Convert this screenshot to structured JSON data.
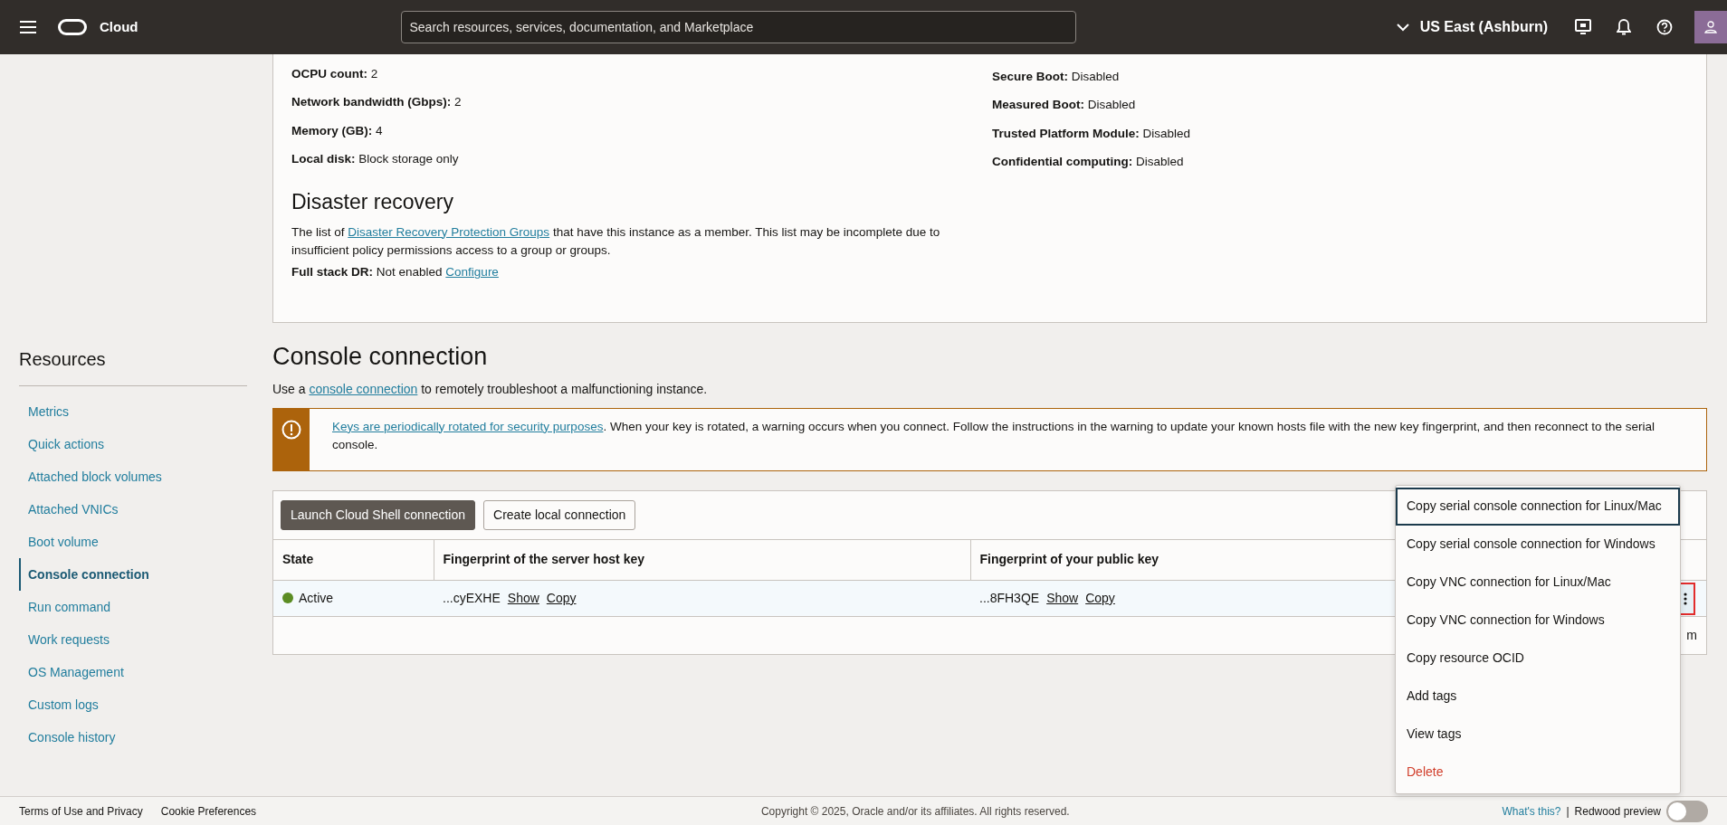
{
  "header": {
    "logo_text": "Cloud",
    "search": {
      "placeholder": "Search resources, services, documentation, and Marketplace"
    },
    "region": "US East (Ashburn)"
  },
  "details": {
    "left": [
      {
        "label": "OCPU count:",
        "value": "2"
      },
      {
        "label": "Network bandwidth (Gbps):",
        "value": "2"
      },
      {
        "label": "Memory (GB):",
        "value": "4"
      },
      {
        "label": "Local disk:",
        "value": "Block storage only"
      }
    ],
    "right": [
      {
        "label": "Secure Boot:",
        "value": "Disabled"
      },
      {
        "label": "Measured Boot:",
        "value": "Disabled"
      },
      {
        "label": "Trusted Platform Module:",
        "value": "Disabled"
      },
      {
        "label": "Confidential computing:",
        "value": "Disabled"
      }
    ],
    "disaster_recovery": {
      "title": "Disaster recovery",
      "text_before": "The list of ",
      "link": "Disaster Recovery Protection Groups",
      "text_after": " that have this instance as a member. This list may be incomplete due to insufficient policy permissions access to a group or groups.",
      "full_stack": {
        "label": "Full stack DR:",
        "value": "Not enabled",
        "link": "Configure"
      }
    }
  },
  "sidebar": {
    "title": "Resources",
    "items": [
      {
        "label": "Metrics",
        "selected": false
      },
      {
        "label": "Quick actions",
        "selected": false
      },
      {
        "label": "Attached block volumes",
        "selected": false
      },
      {
        "label": "Attached VNICs",
        "selected": false
      },
      {
        "label": "Boot volume",
        "selected": false
      },
      {
        "label": "Console connection",
        "selected": true
      },
      {
        "label": "Run command",
        "selected": false
      },
      {
        "label": "Work requests",
        "selected": false
      },
      {
        "label": "OS Management",
        "selected": false
      },
      {
        "label": "Custom logs",
        "selected": false
      },
      {
        "label": "Console history",
        "selected": false
      }
    ]
  },
  "console": {
    "title": "Console connection",
    "intro": {
      "before": "Use a ",
      "link": "console connection",
      "after": " to remotely troubleshoot a malfunctioning instance."
    },
    "alert": {
      "link": "Keys are periodically rotated for security purposes",
      "text": ". When your key is rotated, a warning occurs when you connect. Follow the instructions in the warning to update your known hosts file with the new key fingerprint, and then reconnect to the serial console."
    },
    "buttons": [
      {
        "label": "Launch Cloud Shell connection",
        "kind": "primary"
      },
      {
        "label": "Create local connection",
        "kind": "secondary"
      }
    ],
    "columns": [
      "State",
      "Fingerprint of the server host key",
      "Fingerprint of your public key"
    ],
    "rows": [
      {
        "state": "Active",
        "color": "#5b8c23",
        "server_key": "...cyEXHE",
        "public_key": "...8FH3QE",
        "links": [
          "Show",
          "Copy"
        ],
        "public_links": [
          "Show",
          "Copy"
        ],
        "menu_open": true
      }
    ],
    "footer_text": "m",
    "menu": [
      {
        "label": "Copy serial console connection for Linux/Mac",
        "kind": "normal",
        "focused": true
      },
      {
        "label": "Copy serial console connection for Windows",
        "kind": "normal",
        "focused": false
      },
      {
        "label": "Copy VNC connection for Linux/Mac",
        "kind": "normal",
        "focused": false
      },
      {
        "label": "Copy VNC connection for Windows",
        "kind": "normal",
        "focused": false
      },
      {
        "label": "Copy resource OCID",
        "kind": "normal",
        "focused": false
      },
      {
        "label": "Add tags",
        "kind": "normal",
        "focused": false
      },
      {
        "label": "View tags",
        "kind": "normal",
        "focused": false
      },
      {
        "label": "Delete",
        "kind": "danger",
        "focused": false
      }
    ]
  },
  "footer": {
    "links": [
      "Terms of Use and Privacy",
      "Cookie Preferences"
    ],
    "copyright": "Copyright © 2025, Oracle and/or its affiliates. All rights reserved.",
    "whats_this": "What's this?",
    "separator": "|",
    "toggle_label": "Redwood preview",
    "toggle_on": false
  }
}
